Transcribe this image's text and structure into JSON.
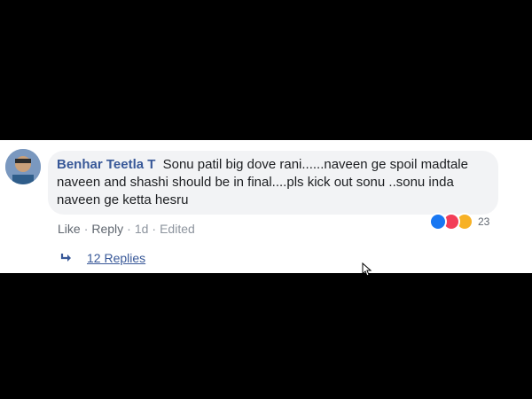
{
  "comment": {
    "author": "Benhar Teetla T",
    "text": "Sonu patil big dove rani......naveen ge spoil madtale naveen and shashi should be in final....pls kick out sonu ..sonu inda naveen ge ketta hesru"
  },
  "actions": {
    "like": "Like",
    "reply": "Reply",
    "time": "1d",
    "edited": "Edited",
    "separator": "·"
  },
  "reactions": {
    "icons": [
      "like-icon",
      "love-icon",
      "wow-icon"
    ],
    "count": "23",
    "colors": {
      "like": "#1877f2",
      "love": "#f33e58",
      "wow": "#f7b125"
    }
  },
  "replies": {
    "icon": "reply-arrow-icon",
    "label": "12 Replies"
  },
  "theme": {
    "author_link": "#385898",
    "bubble_bg": "#f2f3f5",
    "muted_text": "#8d949e"
  }
}
